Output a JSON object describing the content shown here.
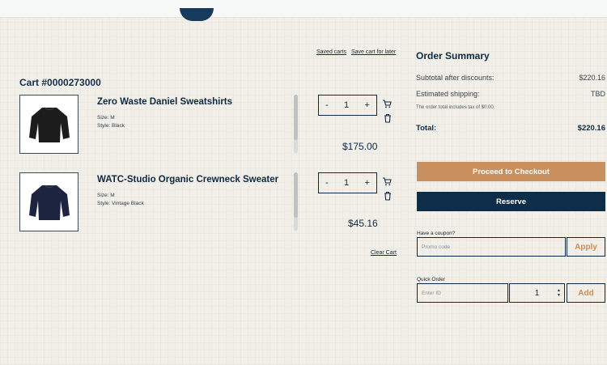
{
  "cart": {
    "saved_carts_link": "Saved carts",
    "save_later_link": "Save cart for later",
    "title": "Cart #0000273000",
    "clear_cart": "Clear Cart",
    "items": [
      {
        "name": "Zero Waste Daniel Sweatshirts",
        "size": "Size: M",
        "style": "Style: Black",
        "qty": "1",
        "price": "$175.00",
        "color": "#1c1c1c"
      },
      {
        "name": "WATC-Studio Organic Crewneck Sweater",
        "size": "Size: M",
        "style": "Style: Vintage Black",
        "qty": "1",
        "price": "$45.16",
        "color": "#1d2440"
      }
    ],
    "qty_minus": "-",
    "qty_plus": "+"
  },
  "summary": {
    "title": "Order Summary",
    "subtotal_label": "Subtotal after discounts:",
    "subtotal_value": "$220.16",
    "shipping_label": "Estimated shipping:",
    "shipping_value": "TBD",
    "tax_note": "The order total includes tax of $0.00.",
    "total_label": "Total:",
    "total_value": "$220.16",
    "checkout_label": "Proceed to Checkout",
    "reserve_label": "Reserve",
    "coupon_label": "Have a coupon?",
    "coupon_placeholder": "Promo code",
    "apply_label": "Apply",
    "quick_order_label": "Quick Order",
    "quick_order_placeholder": "Enter ID",
    "quick_qty": "1",
    "add_label": "Add"
  },
  "colors": {
    "accent": "#c98f5c",
    "navy": "#0e2d48",
    "background": "#f1efe7"
  }
}
